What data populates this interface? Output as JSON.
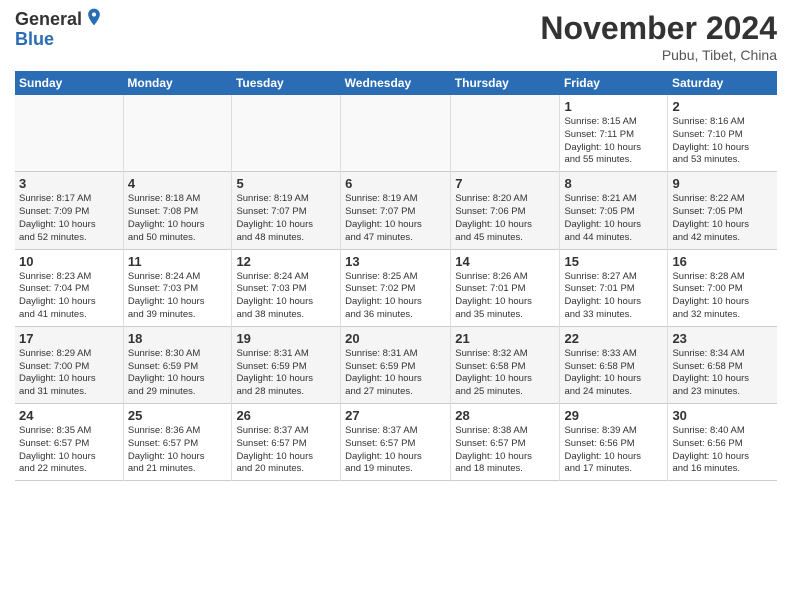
{
  "header": {
    "logo_general": "General",
    "logo_blue": "Blue",
    "month_title": "November 2024",
    "location": "Pubu, Tibet, China"
  },
  "days_of_week": [
    "Sunday",
    "Monday",
    "Tuesday",
    "Wednesday",
    "Thursday",
    "Friday",
    "Saturday"
  ],
  "weeks": [
    [
      {
        "day": "",
        "info": ""
      },
      {
        "day": "",
        "info": ""
      },
      {
        "day": "",
        "info": ""
      },
      {
        "day": "",
        "info": ""
      },
      {
        "day": "",
        "info": ""
      },
      {
        "day": "1",
        "info": "Sunrise: 8:15 AM\nSunset: 7:11 PM\nDaylight: 10 hours\nand 55 minutes."
      },
      {
        "day": "2",
        "info": "Sunrise: 8:16 AM\nSunset: 7:10 PM\nDaylight: 10 hours\nand 53 minutes."
      }
    ],
    [
      {
        "day": "3",
        "info": "Sunrise: 8:17 AM\nSunset: 7:09 PM\nDaylight: 10 hours\nand 52 minutes."
      },
      {
        "day": "4",
        "info": "Sunrise: 8:18 AM\nSunset: 7:08 PM\nDaylight: 10 hours\nand 50 minutes."
      },
      {
        "day": "5",
        "info": "Sunrise: 8:19 AM\nSunset: 7:07 PM\nDaylight: 10 hours\nand 48 minutes."
      },
      {
        "day": "6",
        "info": "Sunrise: 8:19 AM\nSunset: 7:07 PM\nDaylight: 10 hours\nand 47 minutes."
      },
      {
        "day": "7",
        "info": "Sunrise: 8:20 AM\nSunset: 7:06 PM\nDaylight: 10 hours\nand 45 minutes."
      },
      {
        "day": "8",
        "info": "Sunrise: 8:21 AM\nSunset: 7:05 PM\nDaylight: 10 hours\nand 44 minutes."
      },
      {
        "day": "9",
        "info": "Sunrise: 8:22 AM\nSunset: 7:05 PM\nDaylight: 10 hours\nand 42 minutes."
      }
    ],
    [
      {
        "day": "10",
        "info": "Sunrise: 8:23 AM\nSunset: 7:04 PM\nDaylight: 10 hours\nand 41 minutes."
      },
      {
        "day": "11",
        "info": "Sunrise: 8:24 AM\nSunset: 7:03 PM\nDaylight: 10 hours\nand 39 minutes."
      },
      {
        "day": "12",
        "info": "Sunrise: 8:24 AM\nSunset: 7:03 PM\nDaylight: 10 hours\nand 38 minutes."
      },
      {
        "day": "13",
        "info": "Sunrise: 8:25 AM\nSunset: 7:02 PM\nDaylight: 10 hours\nand 36 minutes."
      },
      {
        "day": "14",
        "info": "Sunrise: 8:26 AM\nSunset: 7:01 PM\nDaylight: 10 hours\nand 35 minutes."
      },
      {
        "day": "15",
        "info": "Sunrise: 8:27 AM\nSunset: 7:01 PM\nDaylight: 10 hours\nand 33 minutes."
      },
      {
        "day": "16",
        "info": "Sunrise: 8:28 AM\nSunset: 7:00 PM\nDaylight: 10 hours\nand 32 minutes."
      }
    ],
    [
      {
        "day": "17",
        "info": "Sunrise: 8:29 AM\nSunset: 7:00 PM\nDaylight: 10 hours\nand 31 minutes."
      },
      {
        "day": "18",
        "info": "Sunrise: 8:30 AM\nSunset: 6:59 PM\nDaylight: 10 hours\nand 29 minutes."
      },
      {
        "day": "19",
        "info": "Sunrise: 8:31 AM\nSunset: 6:59 PM\nDaylight: 10 hours\nand 28 minutes."
      },
      {
        "day": "20",
        "info": "Sunrise: 8:31 AM\nSunset: 6:59 PM\nDaylight: 10 hours\nand 27 minutes."
      },
      {
        "day": "21",
        "info": "Sunrise: 8:32 AM\nSunset: 6:58 PM\nDaylight: 10 hours\nand 25 minutes."
      },
      {
        "day": "22",
        "info": "Sunrise: 8:33 AM\nSunset: 6:58 PM\nDaylight: 10 hours\nand 24 minutes."
      },
      {
        "day": "23",
        "info": "Sunrise: 8:34 AM\nSunset: 6:58 PM\nDaylight: 10 hours\nand 23 minutes."
      }
    ],
    [
      {
        "day": "24",
        "info": "Sunrise: 8:35 AM\nSunset: 6:57 PM\nDaylight: 10 hours\nand 22 minutes."
      },
      {
        "day": "25",
        "info": "Sunrise: 8:36 AM\nSunset: 6:57 PM\nDaylight: 10 hours\nand 21 minutes."
      },
      {
        "day": "26",
        "info": "Sunrise: 8:37 AM\nSunset: 6:57 PM\nDaylight: 10 hours\nand 20 minutes."
      },
      {
        "day": "27",
        "info": "Sunrise: 8:37 AM\nSunset: 6:57 PM\nDaylight: 10 hours\nand 19 minutes."
      },
      {
        "day": "28",
        "info": "Sunrise: 8:38 AM\nSunset: 6:57 PM\nDaylight: 10 hours\nand 18 minutes."
      },
      {
        "day": "29",
        "info": "Sunrise: 8:39 AM\nSunset: 6:56 PM\nDaylight: 10 hours\nand 17 minutes."
      },
      {
        "day": "30",
        "info": "Sunrise: 8:40 AM\nSunset: 6:56 PM\nDaylight: 10 hours\nand 16 minutes."
      }
    ]
  ]
}
